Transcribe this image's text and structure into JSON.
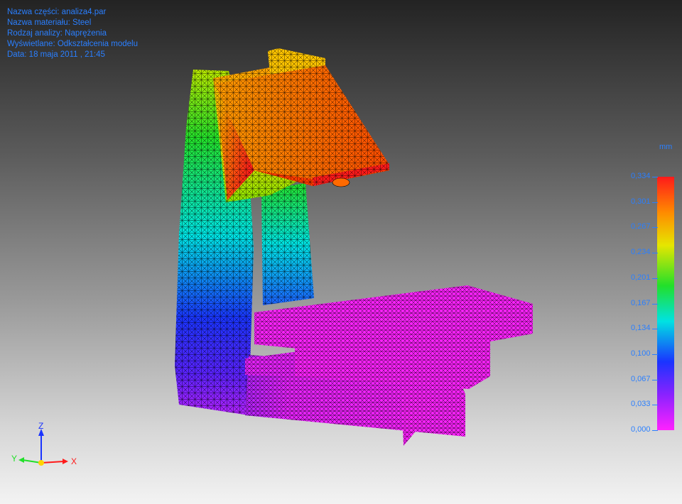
{
  "info": {
    "part_name": "Nazwa części: analiza4.par",
    "material": "Nazwa materiału: Steel",
    "analysis": "Rodzaj analizy: Naprężenia",
    "display": "Wyświetlane: Odkształcenia modelu",
    "date": "Data: 18 maja 2011 , 21:45"
  },
  "legend": {
    "unit": "mm",
    "ticks": [
      "0,334",
      "0,301",
      "0,267",
      "0,234",
      "0,201",
      "0,167",
      "0,134",
      "0,100",
      "0,067",
      "0,033",
      "0,000"
    ]
  },
  "triad": {
    "z": "Z",
    "y": "Y",
    "x": "X"
  },
  "colors": {
    "text": "#2a7fff",
    "red": "#ff1a1a",
    "orange": "#ff7a00",
    "yellow": "#e6e600",
    "green": "#22e02a",
    "cyan": "#00e2e2",
    "blue": "#1a34ff",
    "violet": "#8a22ff",
    "magenta": "#ff22ff"
  }
}
